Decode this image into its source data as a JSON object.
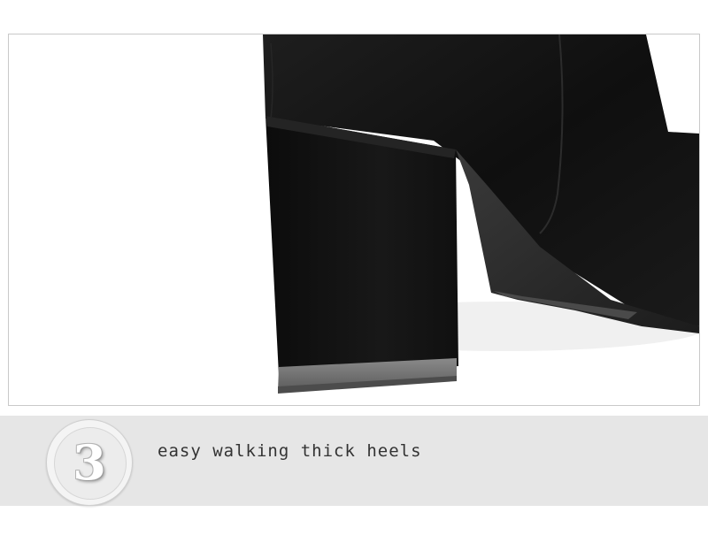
{
  "photo": {
    "subject": "black suede ankle boot heel close-up"
  },
  "caption": {
    "number": "3",
    "text": "easy walking thick heels"
  },
  "colors": {
    "caption_bar": "#e6e6e6",
    "suede": "#141414",
    "sole": "#2a2a2a"
  }
}
